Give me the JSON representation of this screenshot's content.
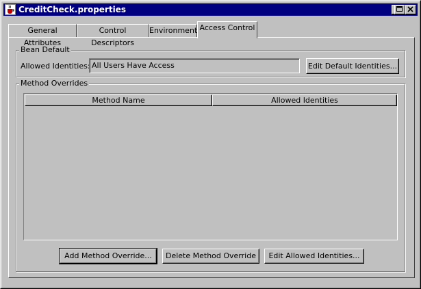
{
  "window": {
    "title": "CreditCheck.properties",
    "app_icon": "coffee-cup-icon",
    "controls": [
      "minimize-icon",
      "maximize-icon",
      "close-icon"
    ]
  },
  "tabs": [
    {
      "label": "General Attributes",
      "active": false
    },
    {
      "label": "Control Descriptors",
      "active": false
    },
    {
      "label": "Environment",
      "active": false
    },
    {
      "label": "Access Control",
      "active": true
    }
  ],
  "bean_default": {
    "group_label": "Bean Default",
    "field_label": "Allowed Identities:",
    "field_value": "All Users Have Access",
    "edit_button": "Edit Default Identities..."
  },
  "method_overrides": {
    "group_label": "Method Overrides",
    "columns": [
      "Method Name",
      "Allowed Identities"
    ],
    "rows": []
  },
  "buttons": {
    "add": "Add Method Override...",
    "delete": "Delete Method Override",
    "edit": "Edit Allowed Identities..."
  }
}
